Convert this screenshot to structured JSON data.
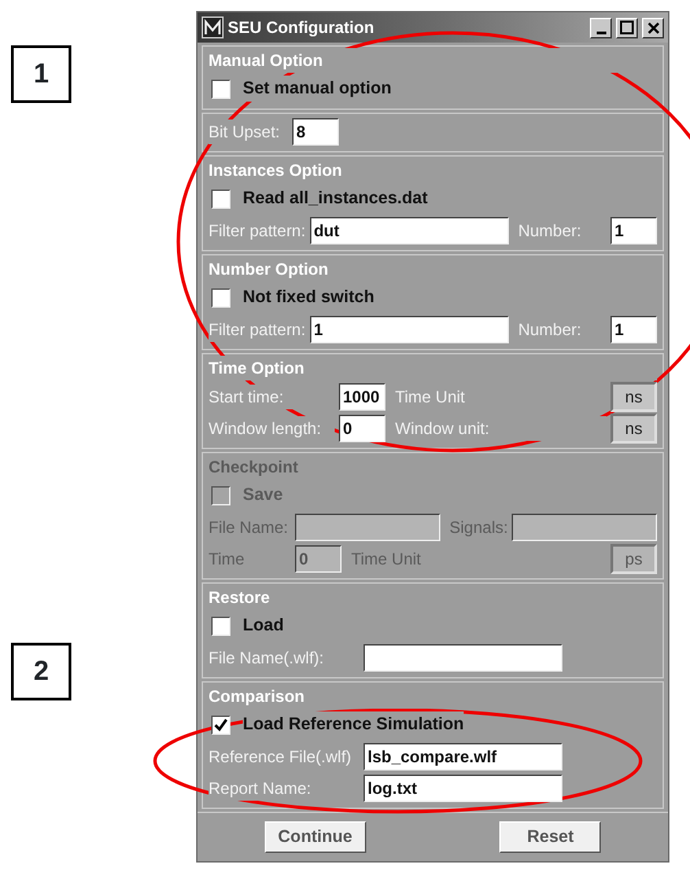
{
  "window": {
    "title": "SEU Configuration"
  },
  "annotations": [
    {
      "label": "1"
    },
    {
      "label": "2"
    }
  ],
  "sections": [
    {
      "title": "Manual Option",
      "disabled": false,
      "rows": [
        {
          "kind": "checkbox",
          "label": "Set manual option",
          "checked": false
        }
      ]
    },
    {
      "disabled": false,
      "rows": [
        {
          "kind": "fields",
          "items": [
            {
              "kind": "label",
              "text": "Bit Upset:"
            },
            {
              "kind": "number-input",
              "value": "8"
            }
          ]
        }
      ]
    },
    {
      "title": "Instances Option",
      "disabled": false,
      "rows": [
        {
          "kind": "checkbox",
          "label": "Read all_instances.dat",
          "checked": false
        },
        {
          "kind": "fields",
          "items": [
            {
              "kind": "label",
              "text": "Filter pattern:"
            },
            {
              "kind": "text-input",
              "value": "dut"
            },
            {
              "kind": "label",
              "text": "Number:"
            },
            {
              "kind": "number-input",
              "value": "1"
            }
          ]
        }
      ]
    },
    {
      "title": "Number Option",
      "disabled": false,
      "rows": [
        {
          "kind": "checkbox",
          "label": "Not fixed switch",
          "checked": false
        },
        {
          "kind": "fields",
          "items": [
            {
              "kind": "label",
              "text": "Filter pattern:"
            },
            {
              "kind": "text-input",
              "value": "1"
            },
            {
              "kind": "label",
              "text": "Number:"
            },
            {
              "kind": "number-input",
              "value": "1"
            }
          ]
        }
      ]
    },
    {
      "title": "Time Option",
      "disabled": false,
      "rows": [
        {
          "kind": "fields",
          "items": [
            {
              "kind": "label",
              "text": "Start time:"
            },
            {
              "kind": "number-input",
              "value": "1000"
            },
            {
              "kind": "label",
              "text": "Time Unit"
            },
            {
              "kind": "unit",
              "value": "ns"
            }
          ]
        },
        {
          "kind": "fields",
          "items": [
            {
              "kind": "label",
              "text": "Window length:"
            },
            {
              "kind": "number-input",
              "value": "0"
            },
            {
              "kind": "label",
              "text": "Window unit:"
            },
            {
              "kind": "unit",
              "value": "ns"
            }
          ]
        }
      ]
    },
    {
      "title": "Checkpoint",
      "disabled": true,
      "rows": [
        {
          "kind": "checkbox",
          "label": "Save",
          "checked": false
        },
        {
          "kind": "fields",
          "items": [
            {
              "kind": "label",
              "text": "File Name:"
            },
            {
              "kind": "text-input",
              "value": ""
            },
            {
              "kind": "label",
              "text": "Signals:"
            },
            {
              "kind": "text-input",
              "value": ""
            }
          ]
        },
        {
          "kind": "fields",
          "items": [
            {
              "kind": "label",
              "text": "Time"
            },
            {
              "kind": "number-input",
              "value": "0"
            },
            {
              "kind": "label",
              "text": "Time Unit"
            },
            {
              "kind": "unit",
              "value": "ps"
            }
          ]
        }
      ]
    },
    {
      "title": "Restore",
      "disabled": false,
      "rows": [
        {
          "kind": "checkbox",
          "label": "Load",
          "checked": false
        },
        {
          "kind": "fields",
          "items": [
            {
              "kind": "label",
              "text": "File Name(.wlf):"
            },
            {
              "kind": "text-input",
              "value": ""
            }
          ]
        }
      ]
    },
    {
      "title": "Comparison",
      "disabled": false,
      "rows": [
        {
          "kind": "checkbox",
          "label": "Load Reference Simulation",
          "checked": true
        },
        {
          "kind": "fields",
          "items": [
            {
              "kind": "label",
              "text": "Reference File(.wlf)"
            },
            {
              "kind": "text-input",
              "value": "lsb_compare.wlf"
            }
          ]
        },
        {
          "kind": "fields",
          "items": [
            {
              "kind": "label",
              "text": "Report Name:"
            },
            {
              "kind": "text-input",
              "value": "log.txt"
            }
          ]
        }
      ]
    }
  ],
  "buttons": [
    "Continue",
    "Reset"
  ]
}
